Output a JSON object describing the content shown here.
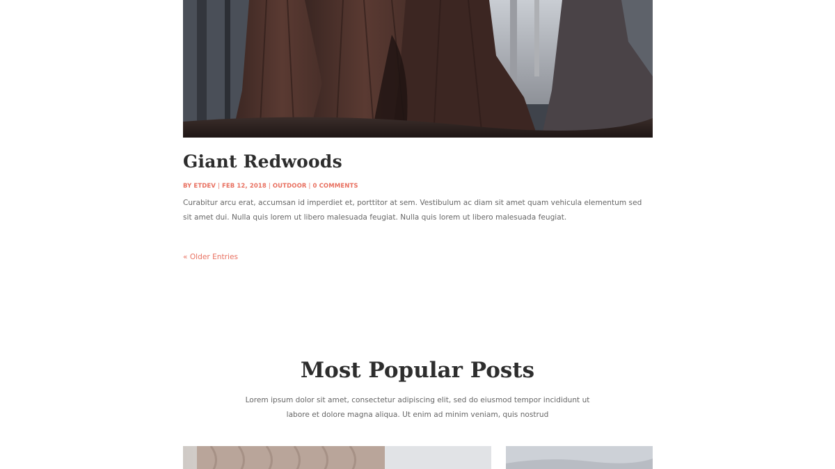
{
  "post": {
    "title": "Giant Redwoods",
    "meta": {
      "author": "BY ETDEV",
      "date": "FEB 12, 2018",
      "category": "OUTDOOR",
      "comments": "0 COMMENTS",
      "separator": "|"
    },
    "excerpt": "Curabitur arcu erat, accumsan id imperdiet et, porttitor at sem. Vestibulum ac diam sit amet quam vehicula elementum sed sit amet dui. Nulla quis lorem ut libero malesuada feugiat. Nulla quis lorem ut libero malesuada feugiat."
  },
  "pagination": {
    "older_entries": "« Older Entries"
  },
  "popular": {
    "title": "Most Popular Posts",
    "description": "Lorem ipsum dolor sit amet, consectetur adipiscing elit, sed do eiusmod tempor incididunt ut labore et dolore magna aliqua. Ut enim ad minim veniam, quis nostrud"
  },
  "colors": {
    "accent": "#e87060",
    "heading": "#2d2d2d",
    "body_text": "#666666"
  }
}
